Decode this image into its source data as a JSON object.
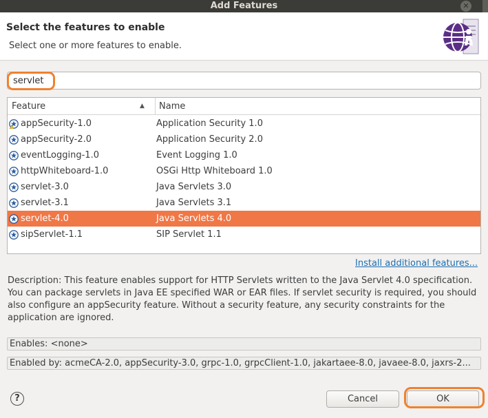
{
  "window": {
    "title": "Add Features"
  },
  "header": {
    "title": "Select the features to enable",
    "subtitle": "Select one or more features to enable."
  },
  "search": {
    "value": "servlet",
    "placeholder": ""
  },
  "table": {
    "columns": [
      "Feature",
      "Name"
    ],
    "sort_column": "Feature",
    "rows": [
      {
        "feature": "appSecurity-1.0",
        "name": "Application Security 1.0",
        "icon": "feature-warning-icon",
        "selected": false
      },
      {
        "feature": "appSecurity-2.0",
        "name": "Application Security 2.0",
        "icon": "feature-icon",
        "selected": false
      },
      {
        "feature": "eventLogging-1.0",
        "name": "Event Logging 1.0",
        "icon": "feature-icon",
        "selected": false
      },
      {
        "feature": "httpWhiteboard-1.0",
        "name": "OSGi Http Whiteboard 1.0",
        "icon": "feature-icon",
        "selected": false
      },
      {
        "feature": "servlet-3.0",
        "name": "Java Servlets 3.0",
        "icon": "feature-icon",
        "selected": false
      },
      {
        "feature": "servlet-3.1",
        "name": "Java Servlets 3.1",
        "icon": "feature-icon",
        "selected": false
      },
      {
        "feature": "servlet-4.0",
        "name": "Java Servlets 4.0",
        "icon": "feature-icon",
        "selected": true
      },
      {
        "feature": "sipServlet-1.1",
        "name": "SIP Servlet 1.1",
        "icon": "feature-icon",
        "selected": false
      }
    ]
  },
  "install_link": "Install additional features...",
  "description": "Description: This feature enables support for HTTP Servlets written to the Java Servlet 4.0 specification. You can package servlets in Java EE specified WAR or EAR files.  If servlet security is required, you should also configure an appSecurity feature. Without a security feature, any security constraints for the application are ignored.",
  "enables": "Enables: <none>",
  "enabled_by": "Enabled by: acmeCA-2.0, appSecurity-3.0, grpc-1.0, grpcClient-1.0, jakartaee-8.0, javaee-8.0, jaxrs-2...",
  "buttons": {
    "help": "?",
    "cancel": "Cancel",
    "ok": "OK"
  },
  "colors": {
    "selection": "#f07746",
    "highlight": "#f0812e",
    "link": "#1c6fb3",
    "titlebar": "#3b3b37"
  }
}
